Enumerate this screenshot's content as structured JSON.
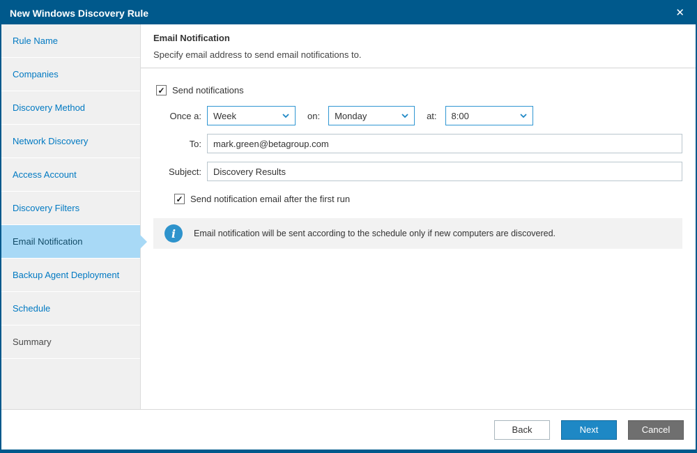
{
  "window": {
    "title": "New Windows Discovery Rule"
  },
  "icons": {
    "close": "✕",
    "check": "✓",
    "info": "i"
  },
  "sidebar": {
    "items": [
      {
        "label": "Rule Name"
      },
      {
        "label": "Companies"
      },
      {
        "label": "Discovery Method"
      },
      {
        "label": "Network Discovery"
      },
      {
        "label": "Access Account"
      },
      {
        "label": "Discovery Filters"
      },
      {
        "label": "Email Notification"
      },
      {
        "label": "Backup Agent Deployment"
      },
      {
        "label": "Schedule"
      },
      {
        "label": "Summary"
      }
    ],
    "active_item": "Email Notification"
  },
  "content": {
    "heading": "Email Notification",
    "subheading": "Specify email address to send email notifications to.",
    "send_notifications": {
      "label": "Send notifications",
      "checked": true
    },
    "schedule": {
      "once_label": "Once a:",
      "once_value": "Week",
      "on_label": "on:",
      "on_value": "Monday",
      "at_label": "at:",
      "at_value": "8:00"
    },
    "to": {
      "label": "To:",
      "value": "mark.green@betagroup.com"
    },
    "subject": {
      "label": "Subject:",
      "value": "Discovery Results"
    },
    "first_run": {
      "label": "Send notification email after the first run",
      "checked": true
    },
    "info": {
      "text": "Email notification will be sent according to the schedule only if new computers are discovered."
    }
  },
  "footer": {
    "back_label": "Back",
    "next_label": "Next",
    "cancel_label": "Cancel"
  },
  "colors": {
    "titlebar": "#00598c",
    "accent_blue": "#1e88c5",
    "sidebar_link": "#0079c2",
    "active_highlight": "#a8d9f6",
    "cancel_gray": "#6f6f6f"
  }
}
